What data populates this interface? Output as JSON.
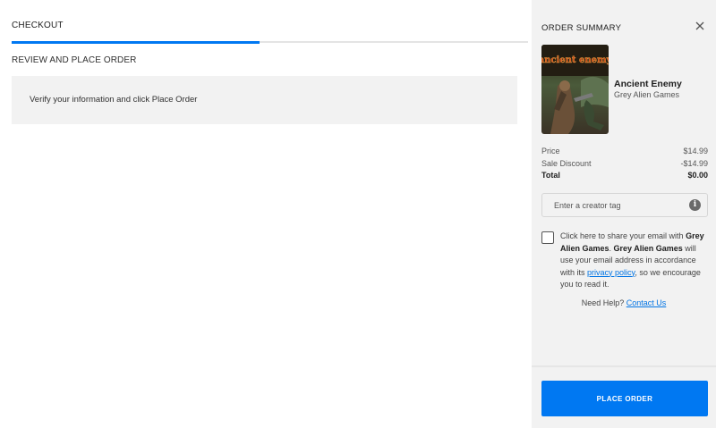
{
  "checkout": {
    "tab_label": "CHECKOUT",
    "progress_fraction": 0.48,
    "section_title": "REVIEW AND PLACE ORDER",
    "info_text": "Verify your information and click Place Order"
  },
  "summary": {
    "title": "ORDER SUMMARY",
    "close_icon": "close-icon",
    "game": {
      "title": "Ancient Enemy",
      "publisher": "Grey Alien Games",
      "art_text": "ancient enemy"
    },
    "price_label": "Price",
    "price_value": "$14.99",
    "discount_label": "Sale Discount",
    "discount_value": "-$14.99",
    "total_label": "Total",
    "total_value": "$0.00",
    "creator_tag_placeholder": "Enter a creator tag",
    "info_icon": "info-icon",
    "consent": {
      "part1": "Click here to share your email with ",
      "publisher_a": "Grey Alien Games",
      "part2": ". ",
      "publisher_b": "Grey Alien Games",
      "part3": " will use your email address in accordance with its ",
      "policy_link": "privacy policy",
      "part4": ", so we encourage you to read it."
    },
    "help_text": "Need Help?",
    "contact_link": "Contact Us",
    "place_order_label": "PLACE ORDER"
  },
  "colors": {
    "accent": "#0078f2",
    "link": "#0074e4",
    "panel_bg": "#f2f2f2"
  }
}
